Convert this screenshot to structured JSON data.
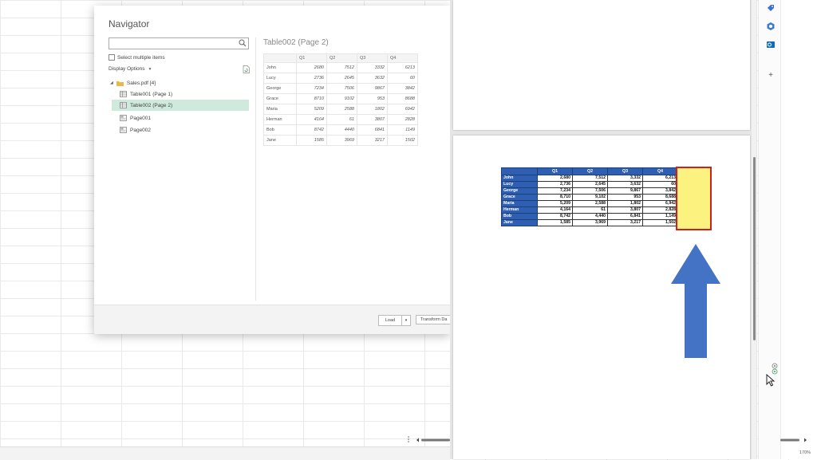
{
  "navigator": {
    "title": "Navigator",
    "search": {
      "value": "",
      "placeholder": ""
    },
    "select_multiple_label": "Select multiple items",
    "display_options_label": "Display Options",
    "tree": {
      "root_label": "Sales.pdf [4]",
      "items": [
        {
          "label": "Table001 (Page 1)",
          "icon": "table-icon"
        },
        {
          "label": "Table002 (Page 2)",
          "icon": "table-icon",
          "selected": true
        },
        {
          "label": "Page001",
          "icon": "page-icon"
        },
        {
          "label": "Page002",
          "icon": "page-icon"
        }
      ]
    },
    "preview": {
      "title": "Table002 (Page 2)",
      "columns": [
        "",
        "Q1",
        "Q2",
        "Q3",
        "Q4"
      ],
      "rows": [
        [
          "John",
          "2680",
          "7512",
          "3332",
          "6213"
        ],
        [
          "Lucy",
          "2736",
          "2645",
          "3632",
          "60"
        ],
        [
          "George",
          "7234",
          "7506",
          "9867",
          "3842"
        ],
        [
          "Grace",
          "8710",
          "9102",
          "953",
          "8688"
        ],
        [
          "Maria",
          "5209",
          "2588",
          "1802",
          "6942"
        ],
        [
          "Herman",
          "4164",
          "61",
          "3807",
          "2828"
        ],
        [
          "Bob",
          "8742",
          "4440",
          "6841",
          "1149"
        ],
        [
          "Jane",
          "1585",
          "3969",
          "3217",
          "1502"
        ]
      ]
    },
    "footer": {
      "load_label": "Load",
      "load_dropdown": "▾",
      "transform_label": "Transform Da"
    }
  },
  "document": {
    "table": {
      "columns": [
        "",
        "Q1",
        "Q2",
        "Q3",
        "Q4"
      ],
      "rows": [
        [
          "John",
          "2,680",
          "7,512",
          "3,332",
          "6,213"
        ],
        [
          "Lucy",
          "2,736",
          "2,645",
          "3,632",
          "60"
        ],
        [
          "George",
          "7,234",
          "7,506",
          "9,867",
          "3,842"
        ],
        [
          "Grace",
          "8,710",
          "9,102",
          "953",
          "8,688"
        ],
        [
          "Maria",
          "5,209",
          "2,588",
          "1,802",
          "6,942"
        ],
        [
          "Herman",
          "4,164",
          "61",
          "3,807",
          "2,828"
        ],
        [
          "Bob",
          "8,742",
          "4,440",
          "6,841",
          "1,149"
        ],
        [
          "Jane",
          "1,585",
          "3,969",
          "3,217",
          "1,502"
        ]
      ]
    },
    "highlight_fill": "#fbf27f",
    "highlight_border": "#d11f1f",
    "arrow_color": "#4472c4"
  },
  "sidebar": {
    "icons": [
      "tag-icon",
      "copilot-icon",
      "outlook-icon",
      "plus-icon"
    ],
    "plus_label": "+"
  },
  "status": {
    "zoom": "170%"
  }
}
